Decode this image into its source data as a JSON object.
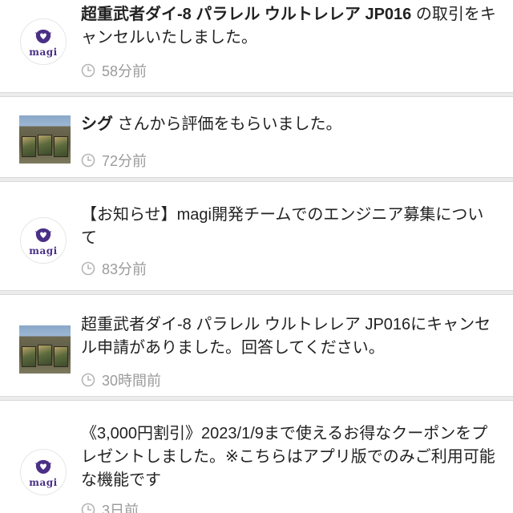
{
  "colors": {
    "brand": "#4a2f86",
    "text": "#222222",
    "muted": "#9b9b9b",
    "separator": "#ececec"
  },
  "notifications": [
    {
      "avatar": "magi-logo",
      "avatar_label": "magi",
      "bold": "超重武者ダイ-8 パラレル ウルトレレア JP016",
      "text": " の取引をキャンセルいたしました。",
      "time": "58分前",
      "time_icon": "clock-icon"
    },
    {
      "avatar": "card-photo",
      "bold": "シグ",
      "text": " さんから評価をもらいました。",
      "time": "72分前",
      "time_icon": "clock-icon"
    },
    {
      "avatar": "magi-logo",
      "avatar_label": "magi",
      "bold": "",
      "text": "【お知らせ】magi開発チームでのエンジニア募集について",
      "time": "83分前",
      "time_icon": "clock-icon"
    },
    {
      "avatar": "card-photo",
      "bold": "",
      "text": "超重武者ダイ-8 パラレル ウルトレレア JP016にキャンセル申請がありました。回答してください。",
      "time": "30時間前",
      "time_icon": "clock-icon"
    },
    {
      "avatar": "magi-logo",
      "avatar_label": "magi",
      "bold": "",
      "text": "《3,000円割引》2023/1/9まで使えるお得なクーポンをプレゼントしました。※こちらはアプリ版でのみご利用可能な機能です",
      "time": "3日前",
      "time_icon": "clock-icon"
    }
  ]
}
